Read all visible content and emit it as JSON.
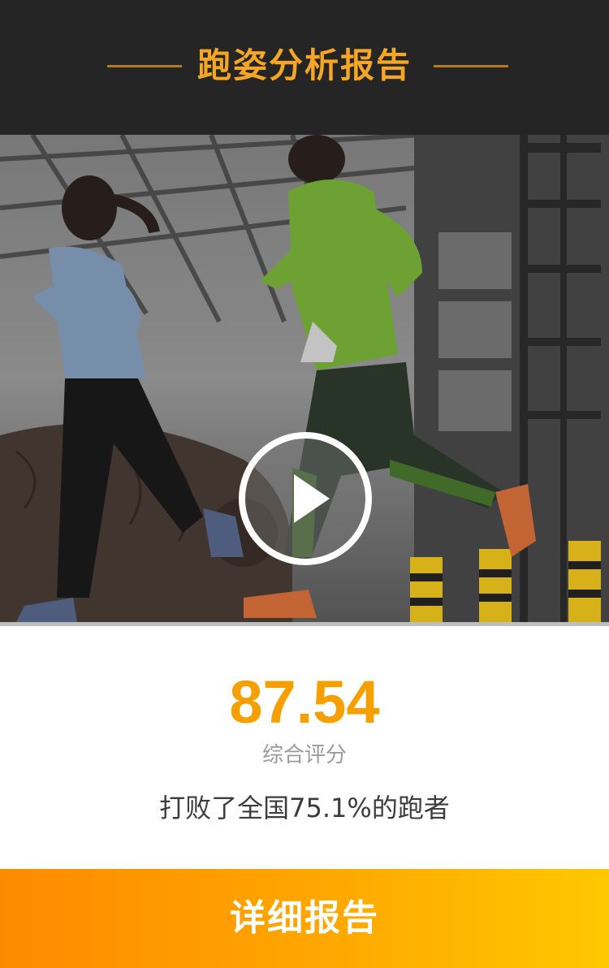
{
  "header": {
    "title": "跑姿分析报告"
  },
  "video": {
    "play_icon": "play-icon"
  },
  "result": {
    "score": "87.54",
    "score_label": "综合评分",
    "beat_text": "打败了全国75.1%的跑者"
  },
  "actions": {
    "detail_label": "详细报告"
  },
  "colors": {
    "accent": "#f5a623",
    "header_bg": "#252525",
    "button_start": "#ff8a00",
    "button_end": "#ffc800"
  }
}
